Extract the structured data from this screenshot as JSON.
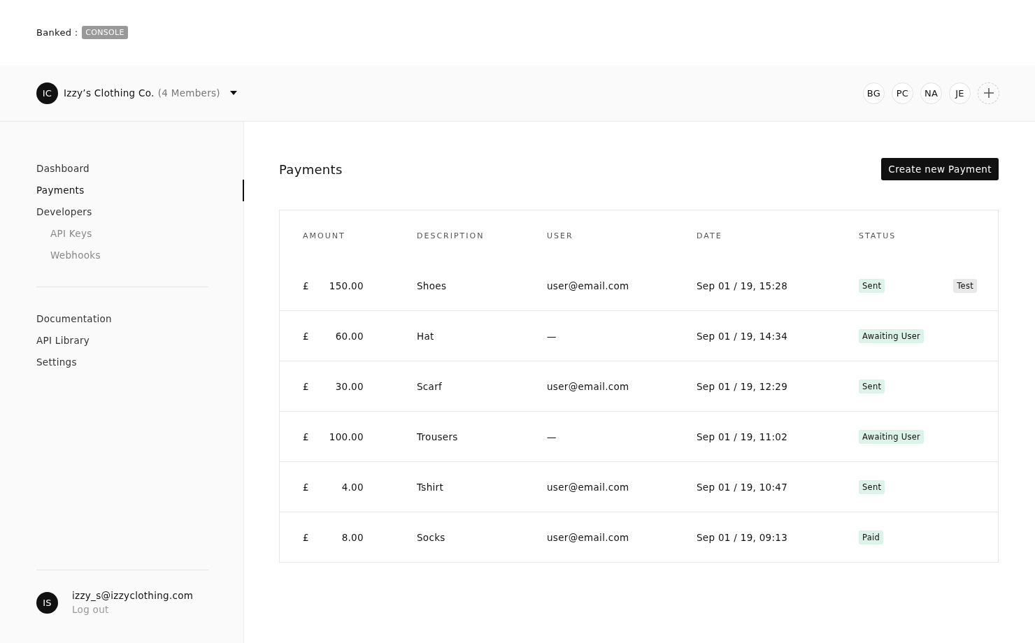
{
  "brand": {
    "name": "Banked :",
    "badge": "CONSOLE"
  },
  "org": {
    "initials": "IC",
    "name": "Izzy’s Clothing Co.",
    "members": "(4 Members)"
  },
  "members": [
    "BG",
    "PC",
    "NA",
    "JE"
  ],
  "sidebar": {
    "items": [
      {
        "label": "Dashboard",
        "selected": false
      },
      {
        "label": "Payments",
        "selected": true
      },
      {
        "label": "Developers",
        "selected": false,
        "children": [
          {
            "label": "API Keys",
            "selected": false
          },
          {
            "label": "Webhooks",
            "selected": false
          }
        ]
      }
    ],
    "links": [
      {
        "label": "Documentation"
      },
      {
        "label": "API Library"
      },
      {
        "label": "Settings"
      }
    ],
    "user": {
      "initials": "IS",
      "email": "izzy_s@izzyclothing.com",
      "logout": "Log out"
    }
  },
  "page": {
    "title": "Payments",
    "action": "Create new Payment"
  },
  "table": {
    "columns": [
      "AMOUNT",
      "DESCRIPTION",
      "USER",
      "DATE",
      "STATUS"
    ],
    "rows": [
      {
        "currency": "£",
        "amount": "150.00",
        "description": "Shoes",
        "user": "user@email.com",
        "date": "Sep 01 / 19, 15:28",
        "status": "Sent",
        "tag": "Test"
      },
      {
        "currency": "£",
        "amount": "60.00",
        "description": "Hat",
        "user": "—",
        "date": "Sep 01 / 19, 14:34",
        "status": "Awaiting User"
      },
      {
        "currency": "£",
        "amount": "30.00",
        "description": "Scarf",
        "user": "user@email.com",
        "date": "Sep 01 / 19, 12:29",
        "status": "Sent"
      },
      {
        "currency": "£",
        "amount": "100.00",
        "description": "Trousers",
        "user": "—",
        "date": "Sep 01 / 19, 11:02",
        "status": "Awaiting User"
      },
      {
        "currency": "£",
        "amount": "4.00",
        "description": "Tshirt",
        "user": "user@email.com",
        "date": "Sep 01 / 19, 10:47",
        "status": "Sent"
      },
      {
        "currency": "£",
        "amount": "8.00",
        "description": "Socks",
        "user": "user@email.com",
        "date": "Sep 01 / 19, 09:13",
        "status": "Paid"
      }
    ]
  }
}
